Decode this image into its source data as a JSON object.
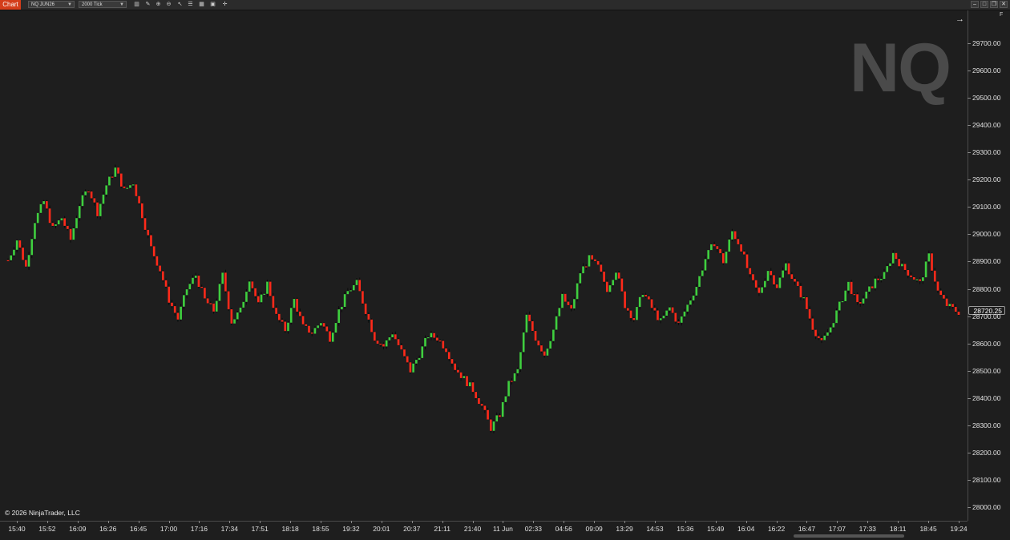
{
  "toolbar": {
    "tab_label": "Chart",
    "instrument": "NQ JUN26",
    "interval": "2000 Tick",
    "icons": [
      "bars-icon",
      "pencil-icon",
      "zoom-in-icon",
      "zoom-out-icon",
      "cursor-icon",
      "properties-icon",
      "template-icon",
      "instrument-icon",
      "crosshair-icon"
    ]
  },
  "watermark": "NQ",
  "copyright": "© 2026 NinjaTrader, LLC",
  "price_marker": "28720.25",
  "y_axis": {
    "labels": [
      "29700.00",
      "29600.00",
      "29500.00",
      "29400.00",
      "29300.00",
      "29200.00",
      "29100.00",
      "29000.00",
      "28900.00",
      "28800.00",
      "28700.00",
      "28600.00",
      "28500.00",
      "28400.00",
      "28300.00",
      "28200.00",
      "28100.00",
      "28000.00"
    ],
    "values": [
      29700,
      29600,
      29500,
      29400,
      29300,
      29200,
      29100,
      29000,
      28900,
      28800,
      28700,
      28600,
      28500,
      28400,
      28300,
      28200,
      28100,
      28000
    ]
  },
  "x_axis": {
    "labels": [
      "15:40",
      "15:52",
      "16:09",
      "16:26",
      "16:45",
      "17:00",
      "17:16",
      "17:34",
      "17:51",
      "18:18",
      "18:55",
      "19:32",
      "20:01",
      "20:37",
      "21:11",
      "21:40",
      "11 Jun",
      "02:33",
      "04:56",
      "09:09",
      "13:29",
      "14:53",
      "15:36",
      "15:49",
      "16:04",
      "16:22",
      "16:47",
      "17:07",
      "17:33",
      "18:11",
      "18:45",
      "19:24"
    ]
  },
  "colors": {
    "up": "#3fcf3f",
    "down": "#ff2a1a",
    "wick": "#0a0a0a",
    "background": "#1e1e1e"
  },
  "chart_data": {
    "type": "candlestick",
    "ylim": [
      27960,
      29800
    ],
    "close_path": [
      [
        0,
        28905
      ],
      [
        3,
        28980
      ],
      [
        6,
        28880
      ],
      [
        9,
        29050
      ],
      [
        12,
        29120
      ],
      [
        15,
        29020
      ],
      [
        18,
        29060
      ],
      [
        21,
        28980
      ],
      [
        24,
        29110
      ],
      [
        27,
        29170
      ],
      [
        30,
        29080
      ],
      [
        33,
        29180
      ],
      [
        36,
        29240
      ],
      [
        39,
        29160
      ],
      [
        42,
        29190
      ],
      [
        45,
        29070
      ],
      [
        48,
        28950
      ],
      [
        51,
        28870
      ],
      [
        54,
        28760
      ],
      [
        57,
        28690
      ],
      [
        60,
        28800
      ],
      [
        63,
        28850
      ],
      [
        66,
        28760
      ],
      [
        69,
        28720
      ],
      [
        72,
        28850
      ],
      [
        75,
        28680
      ],
      [
        78,
        28720
      ],
      [
        81,
        28840
      ],
      [
        84,
        28740
      ],
      [
        87,
        28820
      ],
      [
        90,
        28700
      ],
      [
        93,
        28650
      ],
      [
        96,
        28760
      ],
      [
        99,
        28660
      ],
      [
        102,
        28640
      ],
      [
        105,
        28680
      ],
      [
        108,
        28620
      ],
      [
        111,
        28720
      ],
      [
        114,
        28790
      ],
      [
        117,
        28820
      ],
      [
        120,
        28720
      ],
      [
        123,
        28620
      ],
      [
        126,
        28590
      ],
      [
        129,
        28640
      ],
      [
        132,
        28570
      ],
      [
        135,
        28500
      ],
      [
        138,
        28560
      ],
      [
        141,
        28630
      ],
      [
        144,
        28620
      ],
      [
        147,
        28580
      ],
      [
        150,
        28510
      ],
      [
        153,
        28470
      ],
      [
        156,
        28430
      ],
      [
        159,
        28370
      ],
      [
        162,
        28290
      ],
      [
        165,
        28340
      ],
      [
        168,
        28450
      ],
      [
        171,
        28500
      ],
      [
        174,
        28700
      ],
      [
        177,
        28620
      ],
      [
        180,
        28560
      ],
      [
        183,
        28650
      ],
      [
        186,
        28770
      ],
      [
        189,
        28720
      ],
      [
        192,
        28860
      ],
      [
        195,
        28910
      ],
      [
        198,
        28880
      ],
      [
        201,
        28800
      ],
      [
        204,
        28870
      ],
      [
        207,
        28740
      ],
      [
        210,
        28690
      ],
      [
        213,
        28790
      ],
      [
        216,
        28730
      ],
      [
        219,
        28680
      ],
      [
        222,
        28730
      ],
      [
        225,
        28670
      ],
      [
        228,
        28740
      ],
      [
        231,
        28810
      ],
      [
        234,
        28910
      ],
      [
        237,
        28970
      ],
      [
        240,
        28900
      ],
      [
        243,
        29010
      ],
      [
        246,
        28950
      ],
      [
        249,
        28840
      ],
      [
        252,
        28780
      ],
      [
        255,
        28870
      ],
      [
        258,
        28810
      ],
      [
        261,
        28890
      ],
      [
        264,
        28820
      ],
      [
        267,
        28760
      ],
      [
        270,
        28660
      ],
      [
        273,
        28600
      ],
      [
        276,
        28660
      ],
      [
        279,
        28740
      ],
      [
        282,
        28820
      ],
      [
        285,
        28740
      ],
      [
        288,
        28780
      ],
      [
        291,
        28830
      ],
      [
        294,
        28850
      ],
      [
        297,
        28930
      ],
      [
        300,
        28880
      ],
      [
        303,
        28850
      ],
      [
        306,
        28820
      ],
      [
        309,
        28920
      ],
      [
        312,
        28790
      ],
      [
        315,
        28740
      ],
      [
        318,
        28720
      ],
      [
        320,
        28710
      ]
    ],
    "n_candles": 320
  }
}
